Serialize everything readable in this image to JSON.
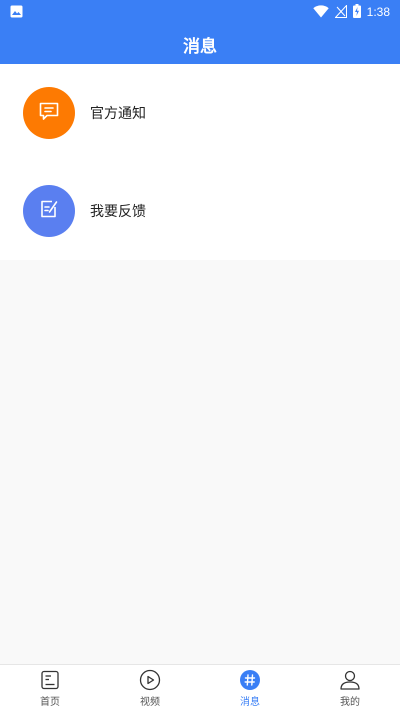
{
  "colors": {
    "primary": "#3a7ff5",
    "notice_orange": "#fd7a02",
    "feedback_blue": "#5a7ff0"
  },
  "status_bar": {
    "time": "1:38",
    "icons": [
      "image-icon",
      "wifi-icon",
      "signal-icon",
      "battery-charging-icon"
    ]
  },
  "header": {
    "title": "消息"
  },
  "list": {
    "items": [
      {
        "label": "官方通知",
        "icon": "message-icon"
      },
      {
        "label": "我要反馈",
        "icon": "edit-icon"
      }
    ]
  },
  "tabbar": {
    "tabs": [
      {
        "label": "首页",
        "icon": "home-doc-icon",
        "active": false
      },
      {
        "label": "视频",
        "icon": "play-icon",
        "active": false
      },
      {
        "label": "消息",
        "icon": "hash-icon",
        "active": true
      },
      {
        "label": "我的",
        "icon": "user-icon",
        "active": false
      }
    ]
  }
}
